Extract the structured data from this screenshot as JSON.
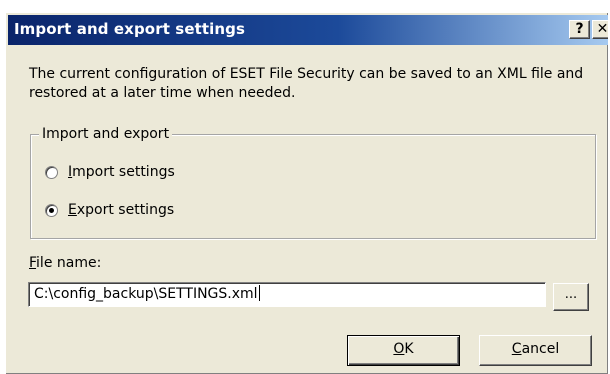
{
  "dialog": {
    "title": "Import and export settings",
    "help_glyph": "?",
    "close_glyph": "✕"
  },
  "description": "The current configuration of ESET File Security can be saved to an XML file and restored at a later time when needed.",
  "import_export_group": {
    "legend": "Import and export",
    "options": [
      {
        "mnemonic": "I",
        "rest": "mport settings",
        "selected": false
      },
      {
        "mnemonic": "E",
        "rest": "xport settings",
        "selected": true
      }
    ]
  },
  "file_name": {
    "label_mnemonic": "F",
    "label_rest": "ile name:",
    "value": "C:\\config_backup\\SETTINGS.xml"
  },
  "buttons": {
    "browse": "...",
    "ok_mnemonic": "O",
    "ok_rest": "K",
    "cancel_mnemonic": "C",
    "cancel_rest": "ancel"
  },
  "colors": {
    "title_gradient_start": "#0a246a",
    "title_gradient_end": "#a6caf0",
    "dialog_face": "#ece9d8"
  }
}
